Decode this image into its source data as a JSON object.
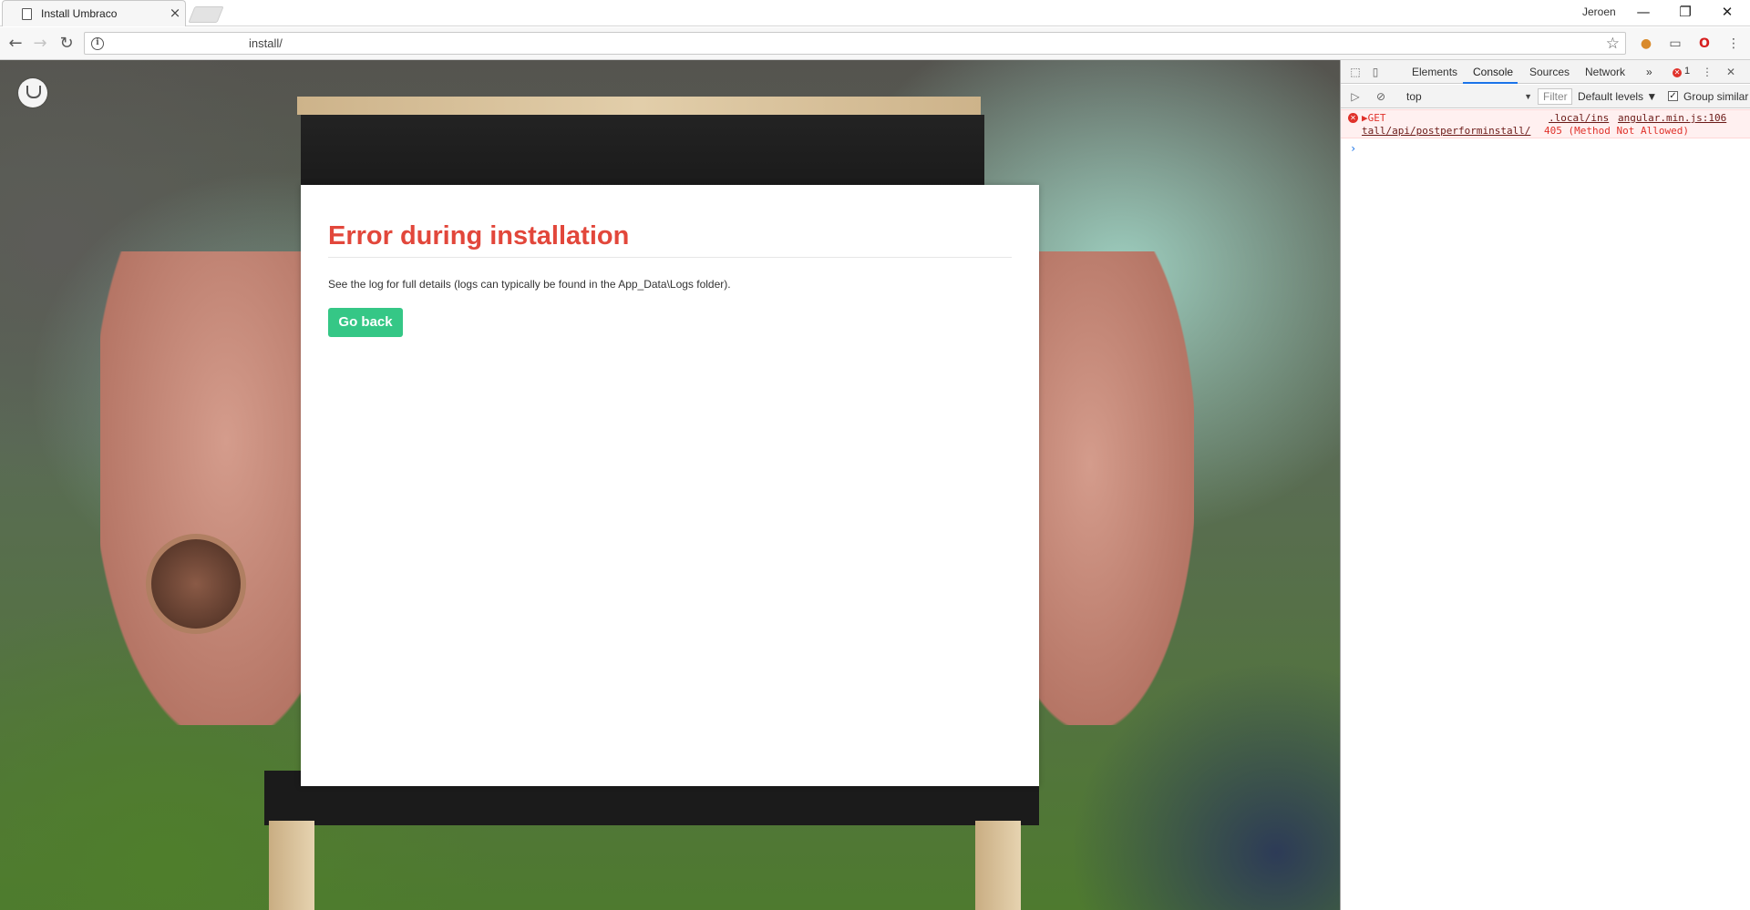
{
  "browser": {
    "tab_title": "Install Umbraco",
    "profile_name": "Jeroen",
    "url": "install/",
    "window_controls": {
      "minimize": "—",
      "restore": "❐",
      "close": "✕"
    }
  },
  "page": {
    "card": {
      "title": "Error during installation",
      "message": "See the log for full details (logs can typically be found in the App_Data\\Logs folder).",
      "go_back_label": "Go back"
    },
    "colors": {
      "title": "#e2473b",
      "button": "#35c786"
    }
  },
  "devtools": {
    "tabs": [
      {
        "label": "Elements"
      },
      {
        "label": "Console"
      },
      {
        "label": "Sources"
      },
      {
        "label": "Network"
      }
    ],
    "active_tab": "Console",
    "overflow": "»",
    "error_count": "1",
    "context": "top",
    "filter_placeholder": "Filter",
    "levels": "Default levels ▼",
    "group_similar": "Group similar",
    "error": {
      "prefix": "▶GET",
      "url_start": ".local/ins",
      "source": "angular.min.js:106",
      "url_rest": "tall/api/postperforminstall/",
      "status": "405 (Method Not Allowed)"
    },
    "prompt": "›"
  }
}
